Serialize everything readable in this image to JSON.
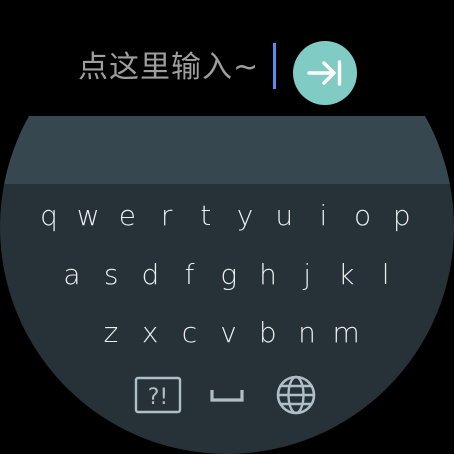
{
  "input": {
    "text": "点这里输入~",
    "send_icon": "send-arrow-to-end-icon"
  },
  "colors": {
    "background": "#000000",
    "suggestion_strip": "#37474f",
    "keyboard_bg": "#263238",
    "key_text": "#eceff1",
    "input_text": "#9e9e9e",
    "cursor": "#5b8def",
    "send_button": "#80cbc4"
  },
  "keyboard": {
    "rows": [
      [
        "q",
        "w",
        "e",
        "r",
        "t",
        "y",
        "u",
        "i",
        "o",
        "p"
      ],
      [
        "a",
        "s",
        "d",
        "f",
        "g",
        "h",
        "j",
        "k",
        "l"
      ],
      [
        "z",
        "x",
        "c",
        "v",
        "b",
        "n",
        "m"
      ]
    ],
    "function_keys": [
      {
        "name": "symbols-key",
        "icon": "symbols-icon",
        "label": "?!"
      },
      {
        "name": "space-key",
        "icon": "space-icon"
      },
      {
        "name": "language-key",
        "icon": "globe-icon"
      }
    ]
  }
}
